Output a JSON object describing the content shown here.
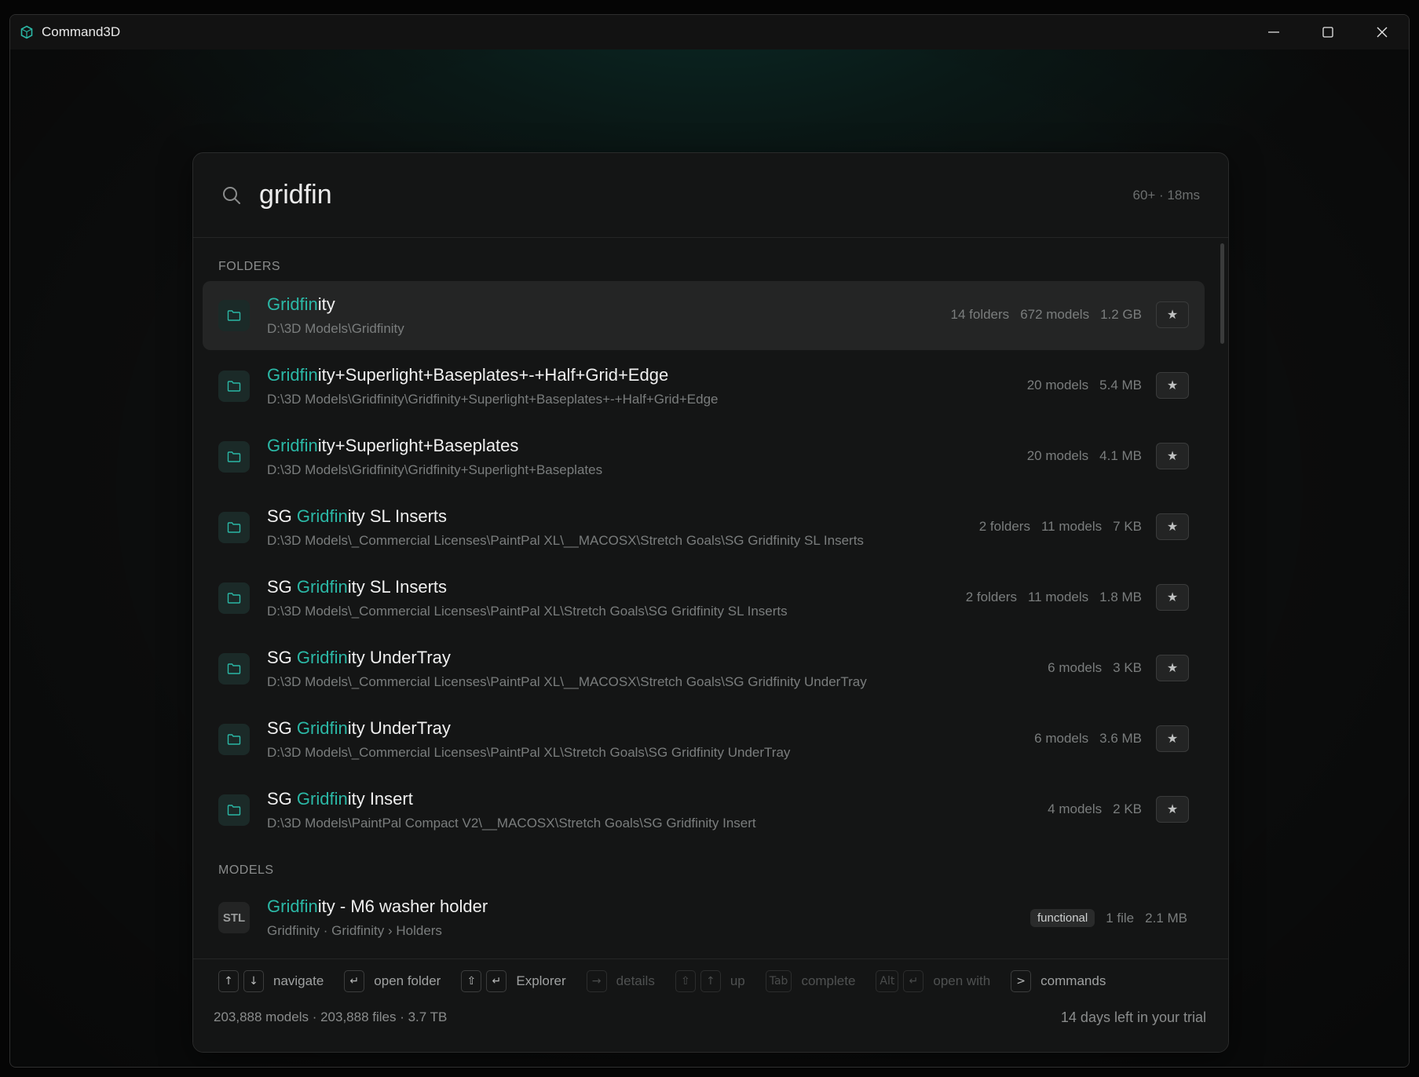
{
  "window": {
    "title": "Command3D"
  },
  "search": {
    "query": "gridfin",
    "meta": "60+ · 18ms"
  },
  "sections": {
    "folders": "FOLDERS",
    "models": "MODELS"
  },
  "folders": [
    {
      "hl": "Gridfin",
      "rest": "ity",
      "prefix": "",
      "path": "D:\\3D Models\\Gridfinity",
      "meta": [
        "14 folders",
        "672 models",
        "1.2 GB"
      ]
    },
    {
      "hl": "Gridfin",
      "rest": "ity+Superlight+Baseplates+-+Half+Grid+Edge",
      "prefix": "",
      "path": "D:\\3D Models\\Gridfinity\\Gridfinity+Superlight+Baseplates+-+Half+Grid+Edge",
      "meta": [
        "20 models",
        "5.4 MB"
      ]
    },
    {
      "hl": "Gridfin",
      "rest": "ity+Superlight+Baseplates",
      "prefix": "",
      "path": "D:\\3D Models\\Gridfinity\\Gridfinity+Superlight+Baseplates",
      "meta": [
        "20 models",
        "4.1 MB"
      ]
    },
    {
      "hl": "Gridfin",
      "rest": "ity SL Inserts",
      "prefix": "SG ",
      "path": "D:\\3D Models\\_Commercial Licenses\\PaintPal XL\\__MACOSX\\Stretch Goals\\SG Gridfinity SL Inserts",
      "meta": [
        "2 folders",
        "11 models",
        "7 KB"
      ]
    },
    {
      "hl": "Gridfin",
      "rest": "ity SL Inserts",
      "prefix": "SG ",
      "path": "D:\\3D Models\\_Commercial Licenses\\PaintPal XL\\Stretch Goals\\SG Gridfinity SL Inserts",
      "meta": [
        "2 folders",
        "11 models",
        "1.8 MB"
      ]
    },
    {
      "hl": "Gridfin",
      "rest": "ity UnderTray",
      "prefix": "SG ",
      "path": "D:\\3D Models\\_Commercial Licenses\\PaintPal XL\\__MACOSX\\Stretch Goals\\SG Gridfinity UnderTray",
      "meta": [
        "6 models",
        "3 KB"
      ]
    },
    {
      "hl": "Gridfin",
      "rest": "ity UnderTray",
      "prefix": "SG ",
      "path": "D:\\3D Models\\_Commercial Licenses\\PaintPal XL\\Stretch Goals\\SG Gridfinity UnderTray",
      "meta": [
        "6 models",
        "3.6 MB"
      ]
    },
    {
      "hl": "Gridfin",
      "rest": "ity Insert",
      "prefix": "SG ",
      "path": "D:\\3D Models\\PaintPal Compact V2\\__MACOSX\\Stretch Goals\\SG Gridfinity Insert",
      "meta": [
        "4 models",
        "2 KB"
      ]
    }
  ],
  "models": [
    {
      "badge": "STL",
      "hl": "Gridfin",
      "rest": "ity - M6 washer holder",
      "prefix": "",
      "path": "Gridfinity · Gridfinity › Holders",
      "tag": "functional",
      "meta": [
        "1 file",
        "2.1 MB"
      ]
    }
  ],
  "star_glyph": "★",
  "hints": [
    {
      "keys": [
        "↑",
        "↓"
      ],
      "label": "navigate",
      "dim": false
    },
    {
      "keys": [
        "↵"
      ],
      "label": "open folder",
      "dim": false
    },
    {
      "keys": [
        "⇧",
        "↵"
      ],
      "label": "Explorer",
      "dim": false
    },
    {
      "keys": [
        "→"
      ],
      "label": "details",
      "dim": true
    },
    {
      "keys": [
        "⇧",
        "↑"
      ],
      "label": "up",
      "dim": true
    },
    {
      "keys": [
        "Tab"
      ],
      "label": "complete",
      "dim": true
    },
    {
      "keys": [
        "Alt",
        "↵"
      ],
      "label": "open with",
      "dim": true
    },
    {
      "keys": [
        ">"
      ],
      "label": "commands",
      "dim": false
    }
  ],
  "footer": {
    "stats": "203,888 models · 203,888 files · 3.7 TB",
    "trial": "14 days left in your trial"
  },
  "colors": {
    "accent": "#2bb8a6",
    "panel": "#141515",
    "selected_row": "#242525"
  }
}
